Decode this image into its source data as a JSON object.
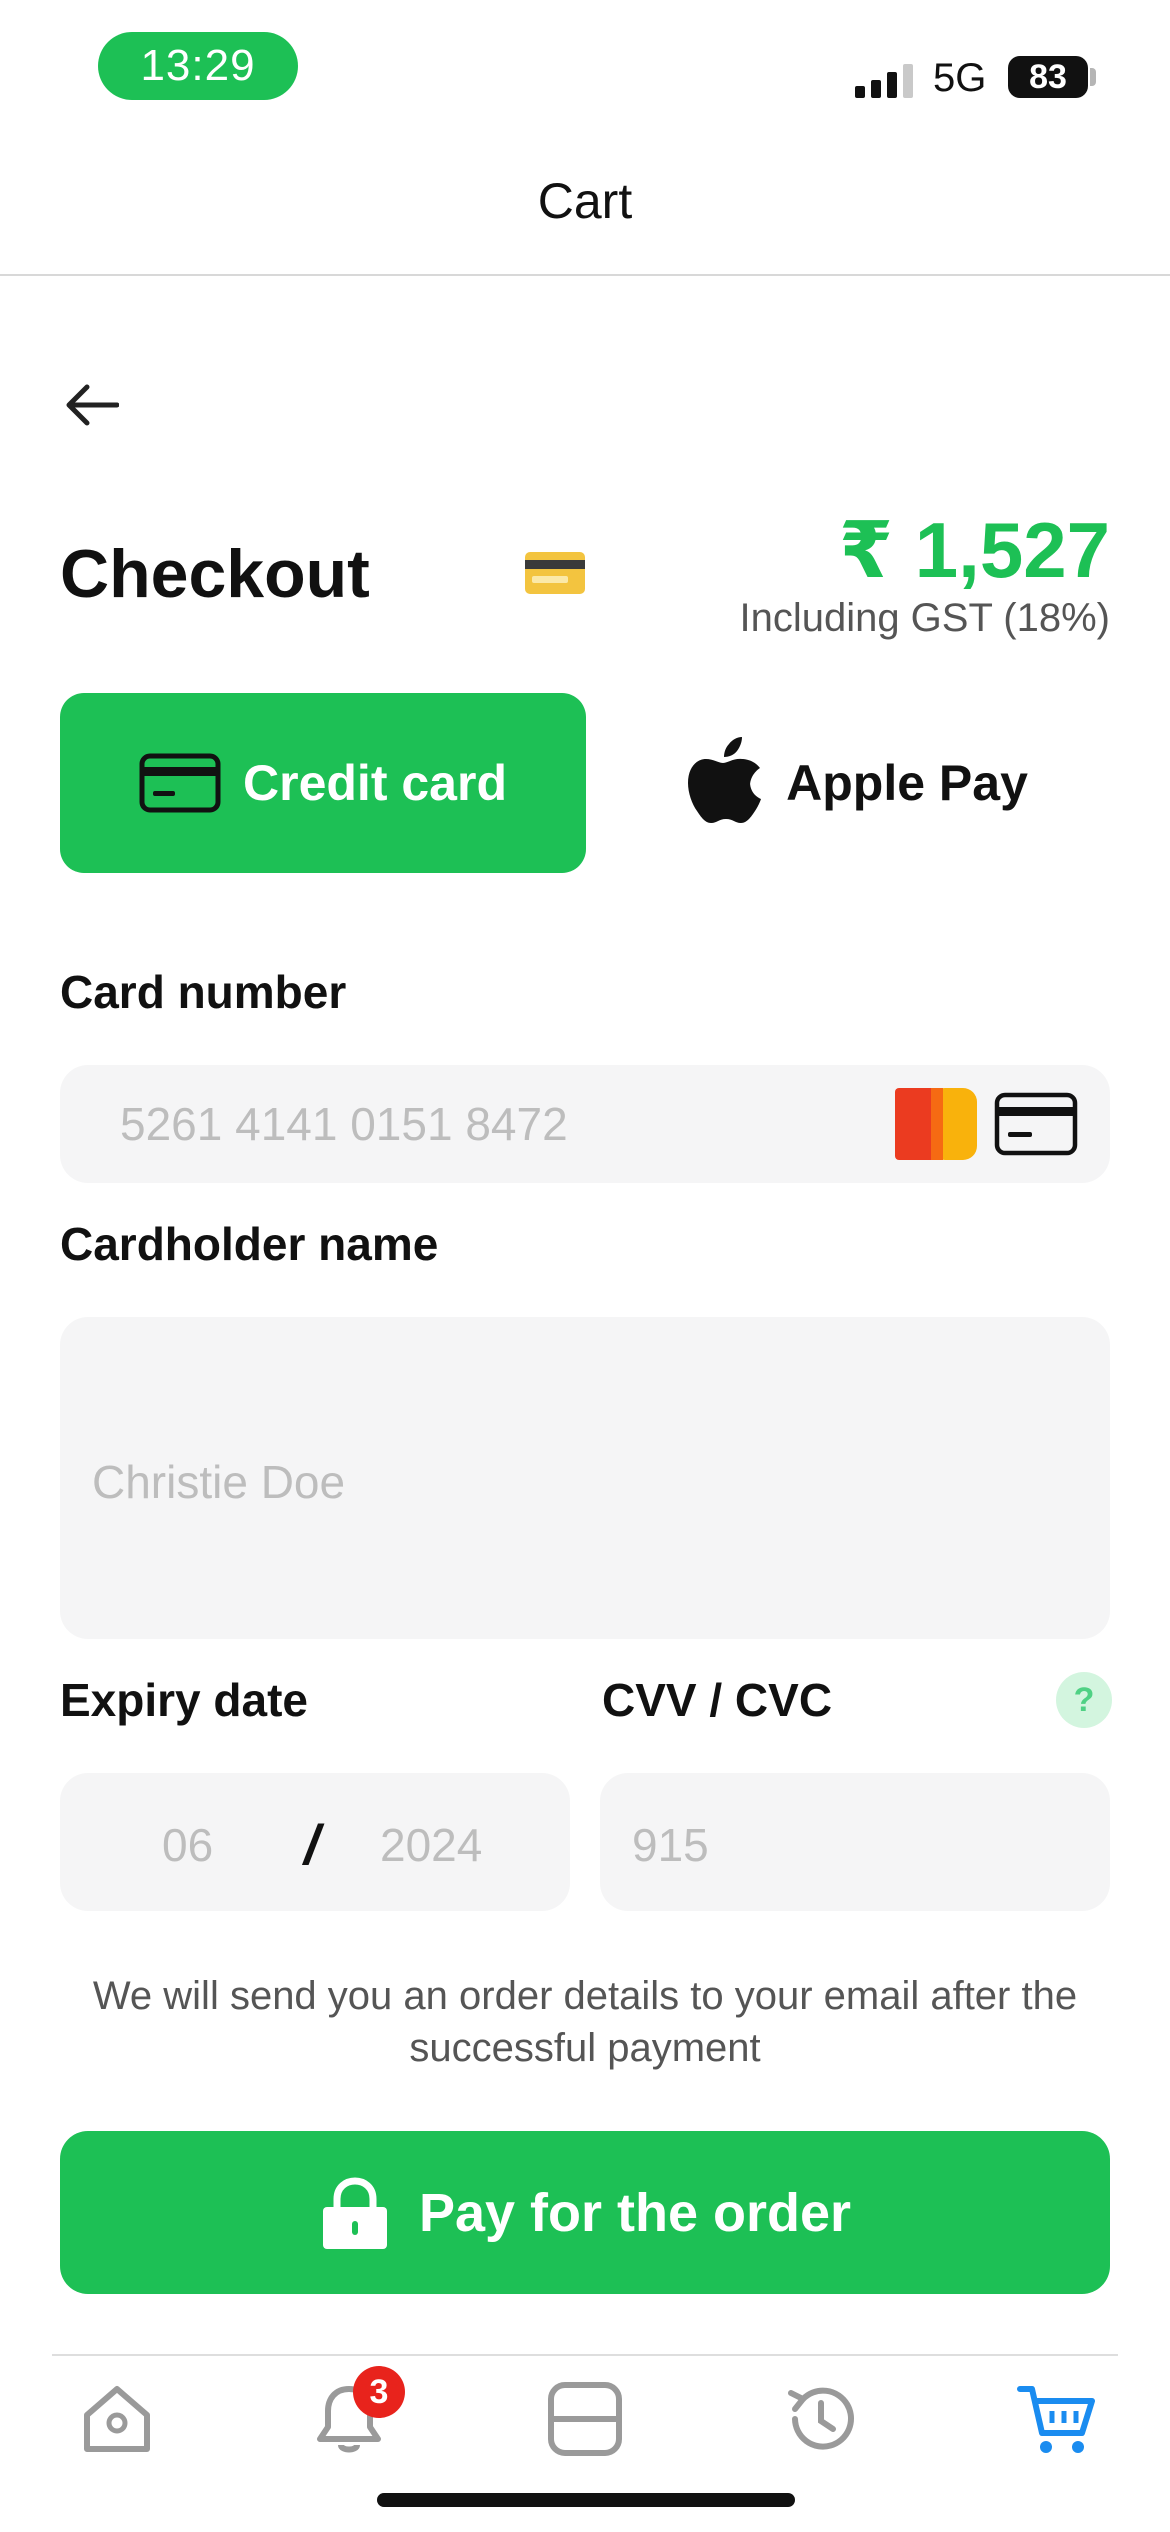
{
  "status_bar": {
    "time": "13:29",
    "network": "5G",
    "battery": "83"
  },
  "header": {
    "title": "Cart"
  },
  "checkout": {
    "title": "Checkout",
    "total": "₹ 1,527",
    "tax_note": "Including GST (18%)"
  },
  "payment_methods": {
    "credit_card_label": "Credit card",
    "apple_pay_label": "Apple Pay",
    "selected": "Credit card"
  },
  "form": {
    "card_number_label": "Card number",
    "card_number_placeholder": "5261 4141 0151 8472",
    "cardholder_label": "Cardholder name",
    "cardholder_placeholder": "Christie Doe",
    "expiry_label": "Expiry date",
    "expiry_month_placeholder": "06",
    "expiry_separator": "/",
    "expiry_year_placeholder": "2024",
    "cvv_label": "CVV / CVC",
    "cvv_placeholder": "915",
    "help_symbol": "?"
  },
  "info_text": "We will send you an order details to your email after the successful payment",
  "pay_button_label": "Pay for the order",
  "bottom_nav": {
    "items": [
      "home-icon",
      "bell-icon",
      "card-icon",
      "history-icon",
      "cart-icon"
    ],
    "active": "cart-icon",
    "notifications_badge": "3"
  },
  "colors": {
    "accent": "#1dc055",
    "active_nav": "#1a8cf0",
    "badge": "#e8231c"
  }
}
